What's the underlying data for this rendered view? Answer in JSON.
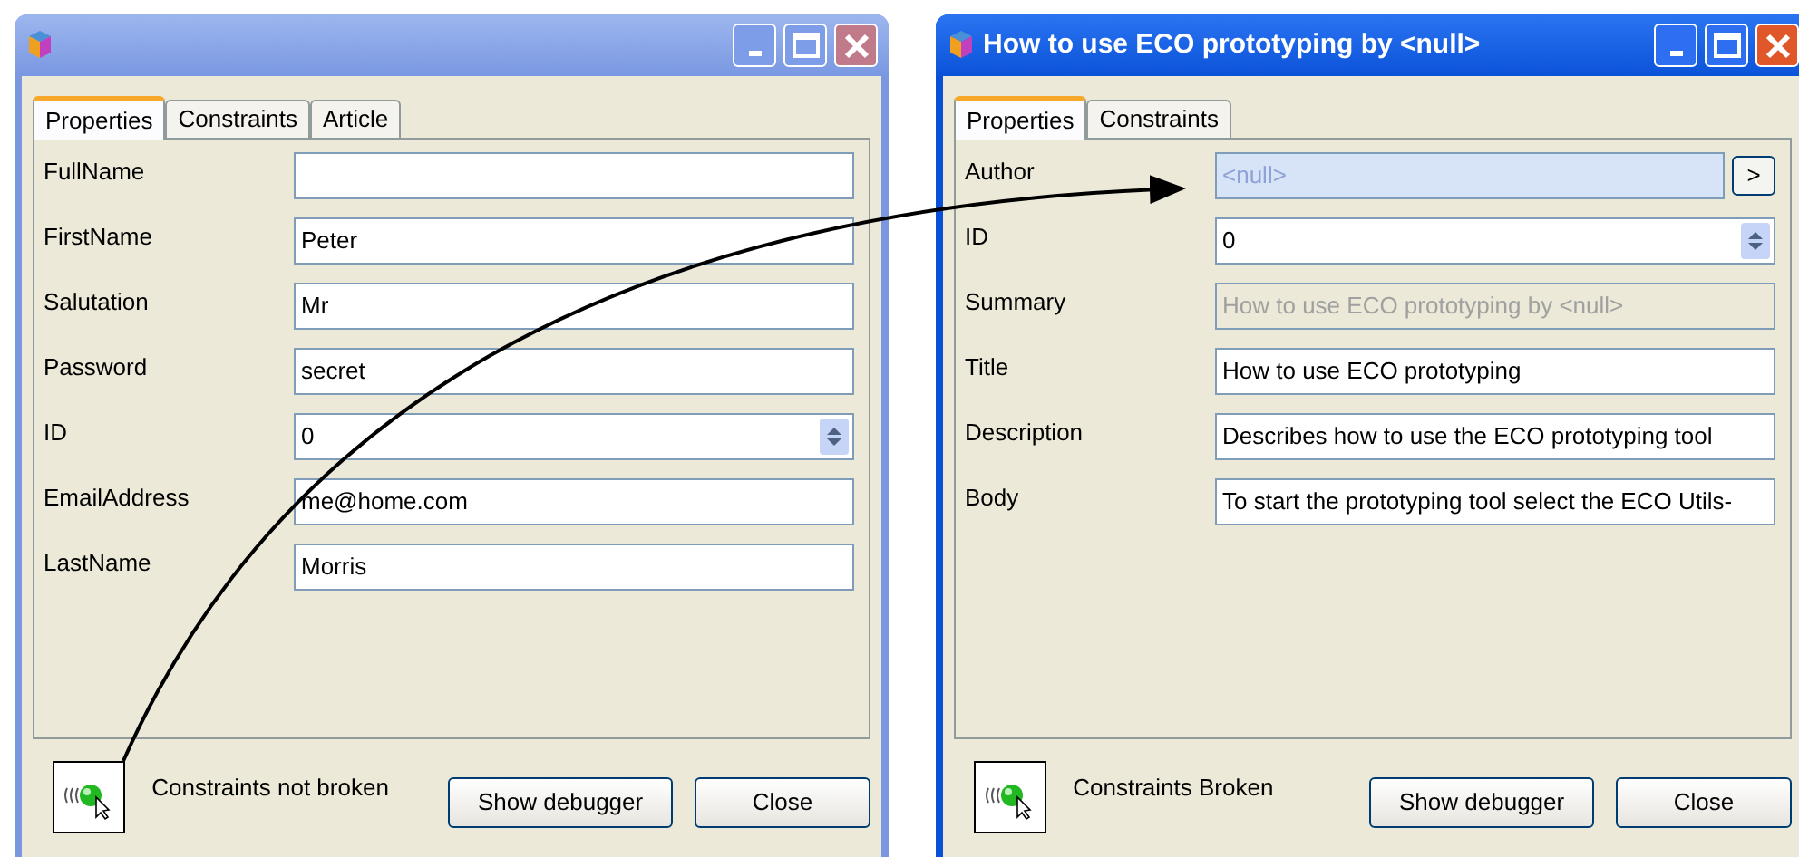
{
  "windows": [
    {
      "active": false,
      "tabs": [
        {
          "label": "Properties",
          "selected": true
        },
        {
          "label": "Constraints",
          "selected": false
        },
        {
          "label": "Article",
          "selected": false
        }
      ],
      "fields": [
        {
          "label": "FullName",
          "kind": "text"
        },
        {
          "label": "FirstName",
          "kind": "text",
          "value": "Peter"
        },
        {
          "label": "Salutation",
          "kind": "text",
          "value": "Mr"
        },
        {
          "label": "Password",
          "kind": "text",
          "value": "secret"
        },
        {
          "label": "ID",
          "kind": "spin",
          "value": "0"
        },
        {
          "label": "EmailAddress",
          "kind": "text",
          "value": "me@home.com"
        },
        {
          "label": "LastName",
          "kind": "text",
          "value": "Morris"
        }
      ],
      "status": "Constraints not broken",
      "buttons": [
        "Show debugger",
        "Close"
      ]
    },
    {
      "active": true,
      "title": "How to use ECO prototyping by <null>",
      "tabs": [
        {
          "label": "Properties",
          "selected": true
        },
        {
          "label": "Constraints",
          "selected": false
        }
      ],
      "fields": [
        {
          "label": "Author",
          "kind": "link",
          "value": "<null>",
          "button": ">"
        },
        {
          "label": "ID",
          "kind": "spin",
          "value": "0"
        },
        {
          "label": "Summary",
          "kind": "readonly",
          "value": "How to use ECO prototyping by <null>"
        },
        {
          "label": "Title",
          "kind": "text",
          "value": "How to use ECO prototyping"
        },
        {
          "label": "Description",
          "kind": "text",
          "value": "Describes how to use the ECO prototyping tool"
        },
        {
          "label": "Body",
          "kind": "text",
          "value": "To start the prototyping tool select the ECO Utils-"
        }
      ],
      "status": "Constraints Broken",
      "buttons": [
        "Show debugger",
        "Close"
      ]
    }
  ]
}
